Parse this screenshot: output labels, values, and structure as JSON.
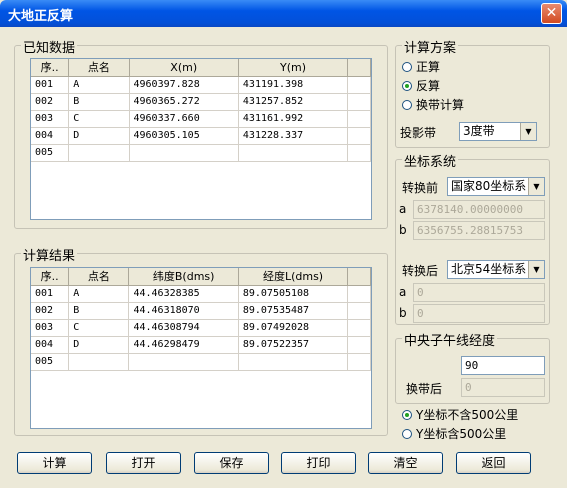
{
  "window": {
    "title": "大地正反算",
    "close_glyph": "✕"
  },
  "known": {
    "group_label": "已知数据",
    "headers": [
      "序..",
      "点名",
      "X(m)",
      "Y(m)"
    ],
    "rows": [
      [
        "001",
        "A",
        "4960397.828",
        "431191.398"
      ],
      [
        "002",
        "B",
        "4960365.272",
        "431257.852"
      ],
      [
        "003",
        "C",
        "4960337.660",
        "431161.992"
      ],
      [
        "004",
        "D",
        "4960305.105",
        "431228.337"
      ],
      [
        "005",
        "",
        "",
        ""
      ]
    ]
  },
  "result": {
    "group_label": "计算结果",
    "headers": [
      "序..",
      "点名",
      "纬度B(dms)",
      "经度L(dms)"
    ],
    "rows": [
      [
        "001",
        "A",
        "44.46328385",
        "89.07505108"
      ],
      [
        "002",
        "B",
        "44.46318070",
        "89.07535487"
      ],
      [
        "003",
        "C",
        "44.46308794",
        "89.07492028"
      ],
      [
        "004",
        "D",
        "44.46298479",
        "89.07522357"
      ],
      [
        "005",
        "",
        "",
        ""
      ]
    ]
  },
  "scheme": {
    "group_label": "计算方案",
    "options": [
      "正算",
      "反算",
      "换带计算"
    ],
    "selected": 1,
    "zone_label": "投影带",
    "zone_value": "3度带"
  },
  "coord": {
    "group_label": "坐标系统",
    "before_label": "转换前",
    "before_value": "国家80坐标系",
    "before_a_label": "a",
    "before_a": "6378140.00000000",
    "before_b_label": "b",
    "before_b": "6356755.28815753",
    "after_label": "转换后",
    "after_value": "北京54坐标系",
    "after_a_label": "a",
    "after_a": "0",
    "after_b_label": "b",
    "after_b": "0"
  },
  "meridian": {
    "group_label": "中央子午线经度",
    "value": "90",
    "after_label": "换带后",
    "after_value": "0"
  },
  "y_option": {
    "options": [
      "Y坐标不含500公里",
      "Y坐标含500公里"
    ],
    "selected": 0
  },
  "buttons": [
    "计算",
    "打开",
    "保存",
    "打印",
    "清空",
    "返回"
  ],
  "colors": {
    "titlebar": "#0055e5",
    "face": "#ece9d8",
    "border": "#7f9db9"
  }
}
